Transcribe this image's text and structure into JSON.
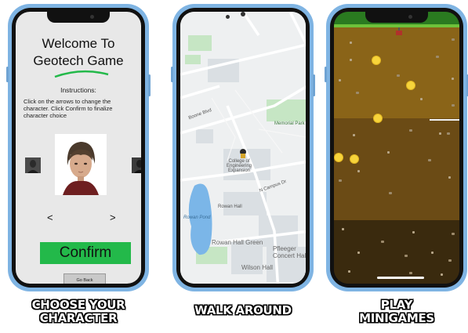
{
  "screen1": {
    "welcome_line1": "Welcome To",
    "welcome_line2": "Geotech Game",
    "instructions_title": "Instructions:",
    "instructions_text": "Click on the arrows to change the character. Click Confirm to finalize character choice",
    "prev_arrow": "<",
    "next_arrow": ">",
    "confirm_label": "Confirm",
    "goback_label": "Go Back",
    "accent_green": "#23b94a"
  },
  "screen2": {
    "labels": {
      "boone_blvd": "Boone Blvd",
      "engineering": "College of Engineering Expansion",
      "campus_dr": "N Campus Dr",
      "rowan_hall": "Rowan Hall",
      "rowan_pond": "Rowan Pond",
      "rowan_hall_green": "Rowan Hall Green",
      "pfleeger": "Pfleeger Concert Hall",
      "wilson_hall": "Wilson Hall",
      "memorial": "Memorial Park"
    }
  },
  "captions": {
    "choose_line1": "CHOOSE YOUR",
    "choose_line2": "CHARACTER",
    "walk": "WALK AROUND",
    "play_line1": "PLAY",
    "play_line2": "MINIGAMES"
  }
}
